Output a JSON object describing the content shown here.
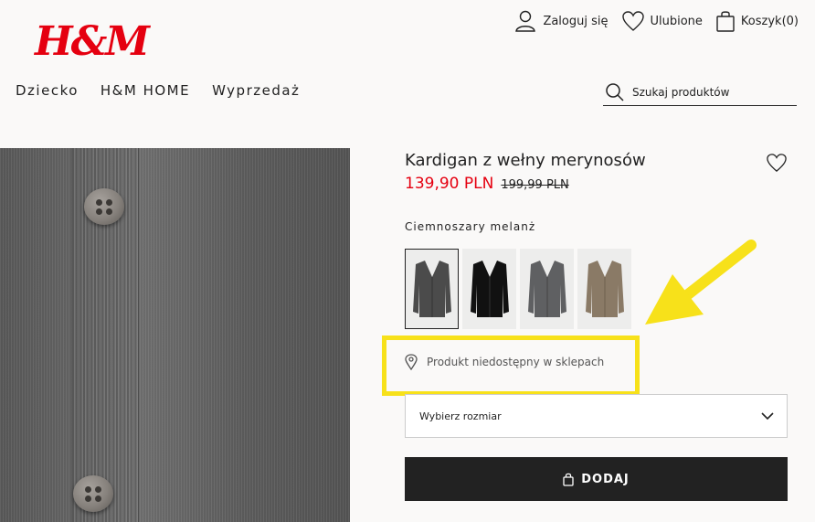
{
  "header": {
    "logo": "H&M",
    "nav": [
      "Dziecko",
      "H&M HOME",
      "Wyprzedaż"
    ],
    "account": {
      "login_label": "Zaloguj się",
      "login_icon": "user-icon",
      "favorites_label": "Ulubione",
      "favorites_icon": "heart-icon",
      "cart_label": "Koszyk(0)",
      "cart_icon": "bag-icon"
    },
    "search": {
      "placeholder": "Szukaj produktów",
      "icon": "search-icon"
    }
  },
  "product": {
    "title": "Kardigan z wełny merynosów",
    "price_sale": "139,90 PLN",
    "price_original": "199,99 PLN",
    "color_name": "Ciemnoszary melanż",
    "swatches": [
      {
        "name": "Ciemnoszary melanż",
        "color": "#4b4b4b",
        "selected": true
      },
      {
        "name": "Czarny",
        "color": "#111111",
        "selected": false
      },
      {
        "name": "Szary",
        "color": "#5f6062",
        "selected": false
      },
      {
        "name": "Beżowy",
        "color": "#8a7a66",
        "selected": false
      }
    ],
    "availability": "Produkt niedostępny w sklepach",
    "size_select": "Wybierz rozmiar",
    "add_button": "DODAJ"
  },
  "colors": {
    "brand_red": "#e50010",
    "highlight": "#f7e11a",
    "button_dark": "#222222"
  }
}
